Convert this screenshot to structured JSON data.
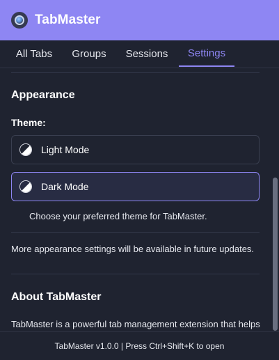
{
  "header": {
    "title": "TabMaster",
    "logo_icon": "tabmaster-logo-icon"
  },
  "tabs": [
    {
      "label": "All Tabs",
      "active": false
    },
    {
      "label": "Groups",
      "active": false
    },
    {
      "label": "Sessions",
      "active": false
    },
    {
      "label": "Settings",
      "active": true
    }
  ],
  "appearance": {
    "title": "Appearance",
    "theme_label": "Theme:",
    "options": [
      {
        "label": "Light Mode",
        "icon": "half-circle-icon",
        "selected": false
      },
      {
        "label": "Dark Mode",
        "icon": "half-circle-icon",
        "selected": true
      }
    ],
    "help_text": "Choose your preferred theme for TabMaster.",
    "more_text": "More appearance settings will be available in future updates."
  },
  "about": {
    "title": "About TabMaster",
    "text": "TabMaster is a powerful tab management extension that helps"
  },
  "footer": {
    "text": "TabMaster v1.0.0 | Press Ctrl+Shift+K to open"
  },
  "colors": {
    "accent": "#8e86f3",
    "background": "#1f2330",
    "selected_bg": "#282c43"
  }
}
